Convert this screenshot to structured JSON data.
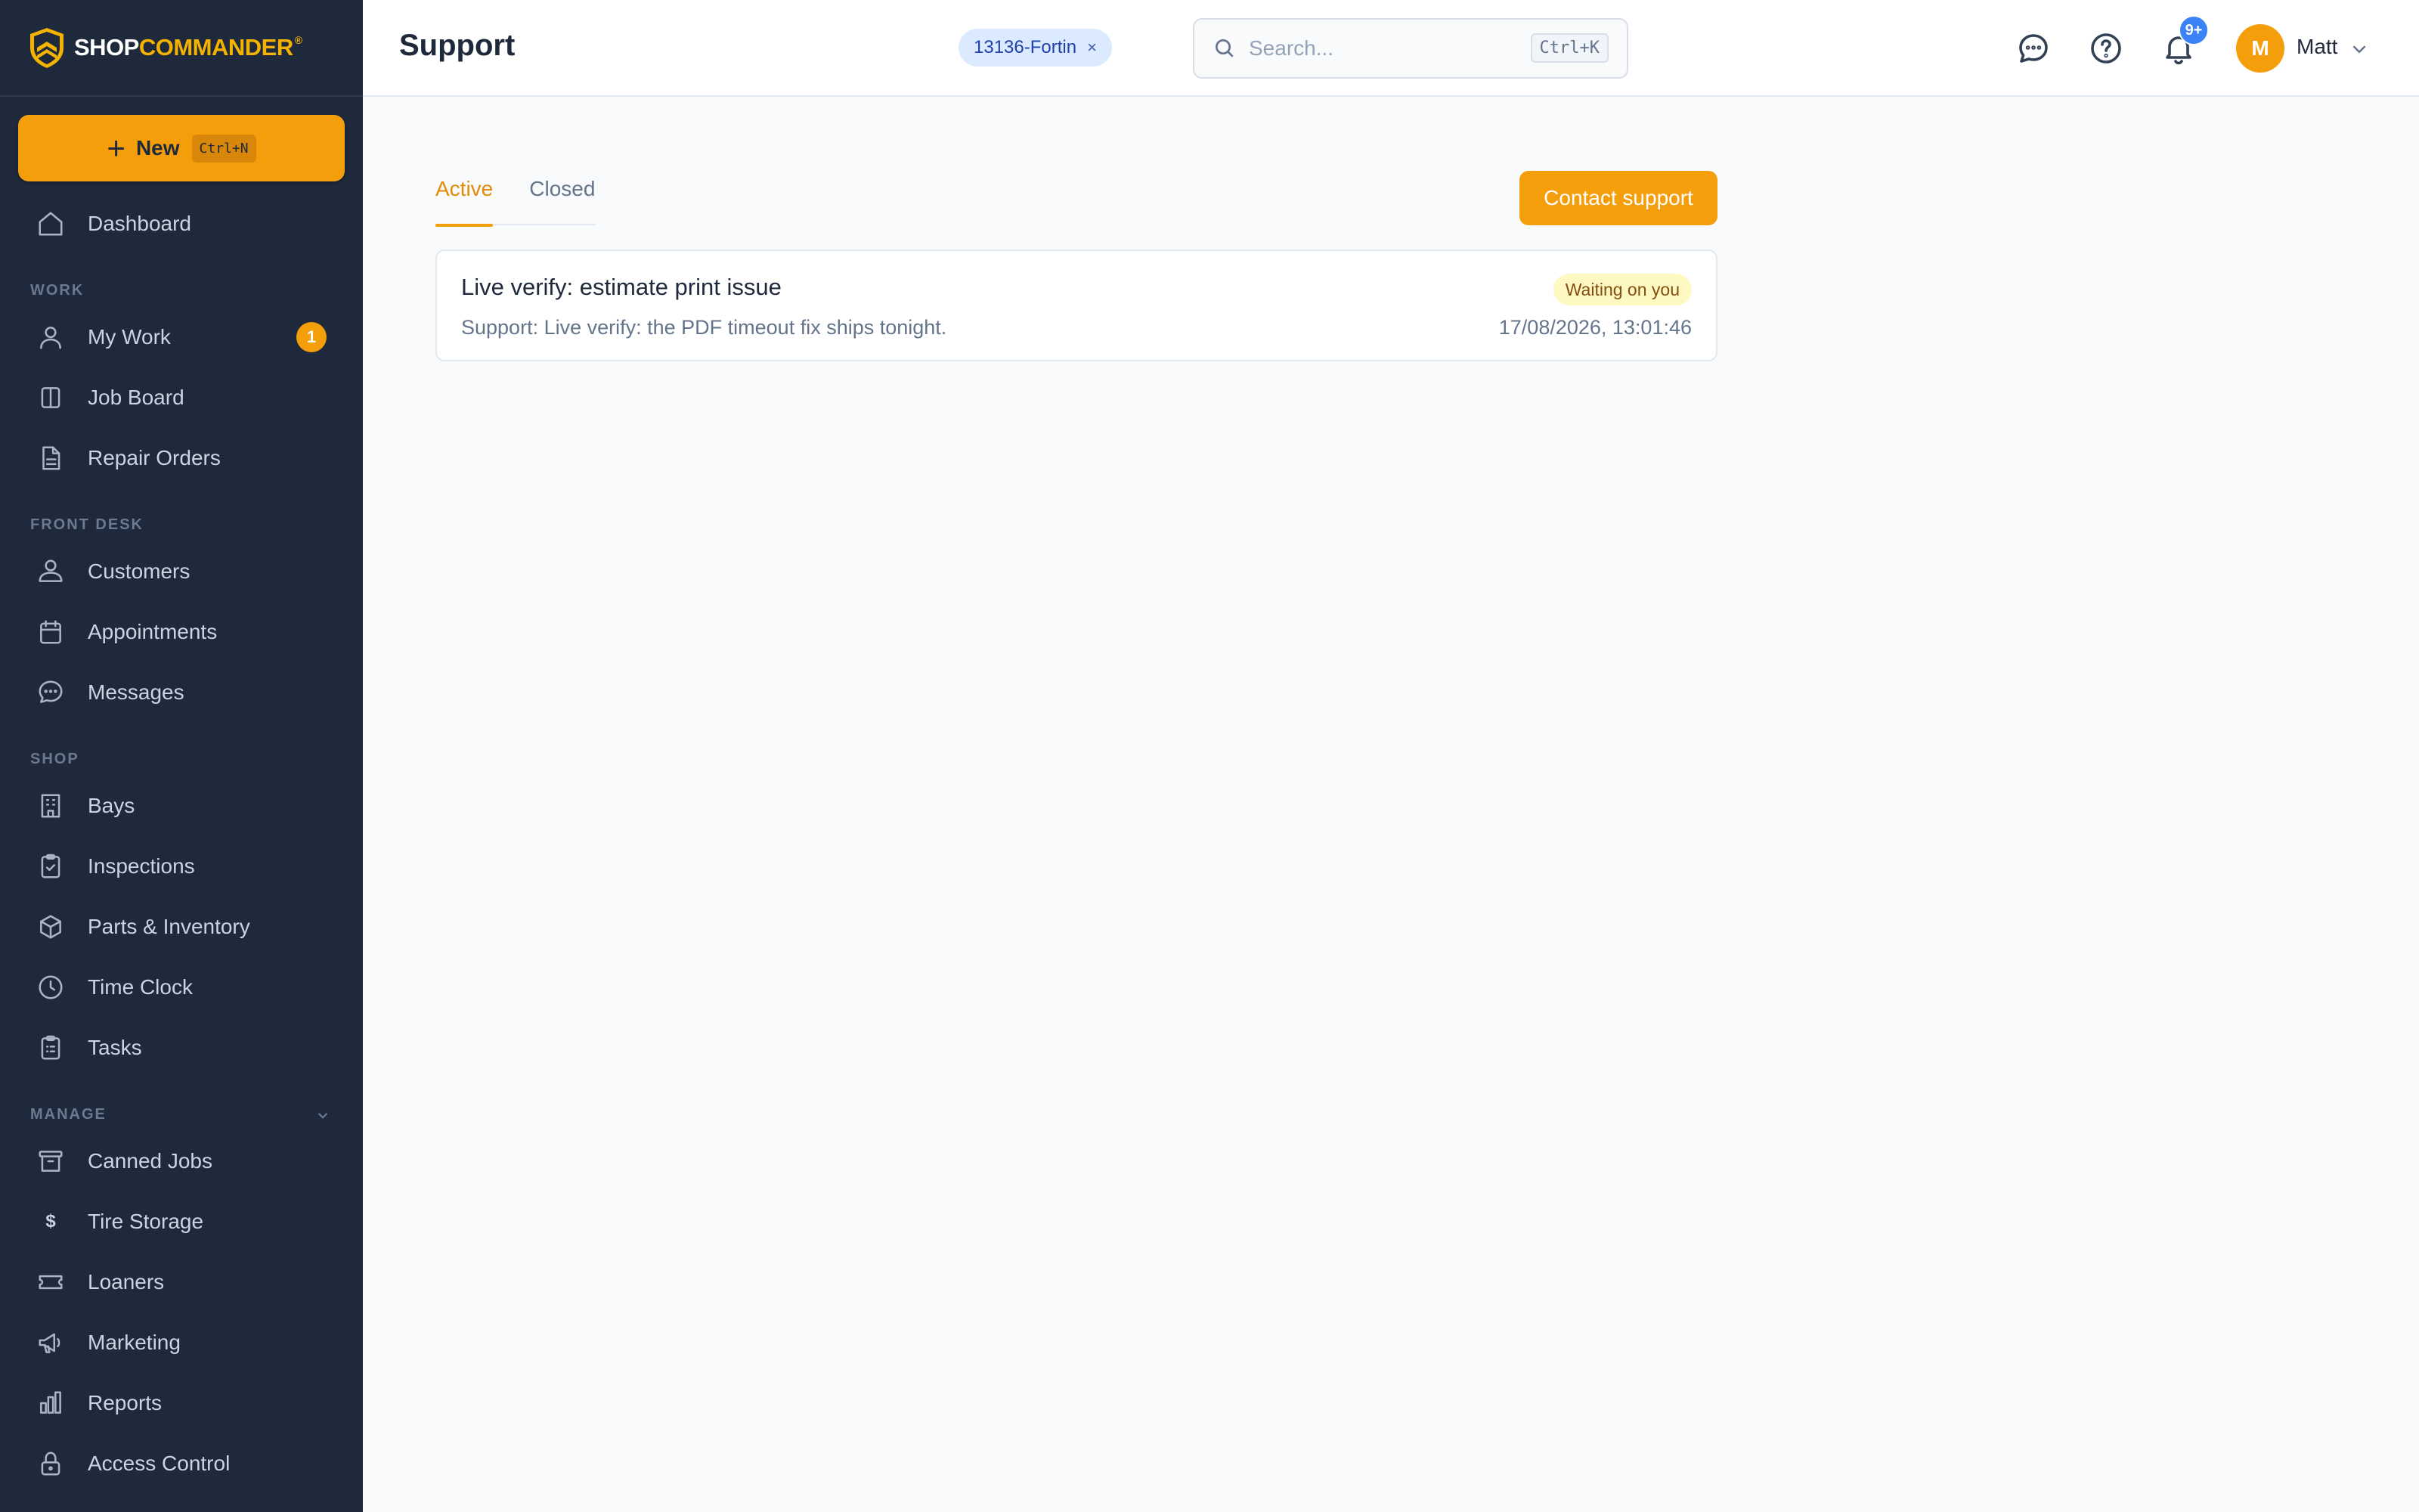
{
  "brand": {
    "part1": "SHOP",
    "part2": "COMMANDER",
    "reg": "®"
  },
  "new_button": {
    "label": "New",
    "shortcut": "Ctrl+N"
  },
  "sidebar": {
    "top_item": "Dashboard",
    "sections": {
      "work": "WORK",
      "front_desk": "FRONT DESK",
      "shop": "SHOP",
      "manage": "MANAGE"
    },
    "work_items": [
      "My Work",
      "Job Board",
      "Repair Orders"
    ],
    "my_work_badge": "1",
    "front_desk_items": [
      "Customers",
      "Appointments",
      "Messages"
    ],
    "shop_items": [
      "Bays",
      "Inspections",
      "Parts & Inventory",
      "Time Clock",
      "Tasks"
    ],
    "manage_items": [
      "Canned Jobs",
      "Tire Storage",
      "Loaners",
      "Marketing",
      "Reports",
      "Access Control"
    ],
    "tire_storage_glyph": "$"
  },
  "header": {
    "title": "Support",
    "tenant_chip": "13136-Fortin",
    "tenant_chip_close": "×",
    "search_placeholder": "Search...",
    "search_shortcut": "Ctrl+K",
    "notification_badge": "9+",
    "user_initial": "M",
    "user_name": "Matt"
  },
  "tabs": {
    "active": "Active",
    "closed": "Closed"
  },
  "contact_button": "Contact support",
  "tickets": [
    {
      "title": "Live verify: estimate print issue",
      "status": "Waiting on you",
      "description": "Support: Live verify: the PDF timeout fix ships tonight.",
      "timestamp": "17/08/2026, 13:01:46"
    }
  ],
  "colors": {
    "sidebar_bg": "#1e293b",
    "accent": "#f59e0b",
    "status_waiting_bg": "#fef9c3",
    "notification_badge": "#3b82f6",
    "chip_bg": "#dbeafe"
  }
}
